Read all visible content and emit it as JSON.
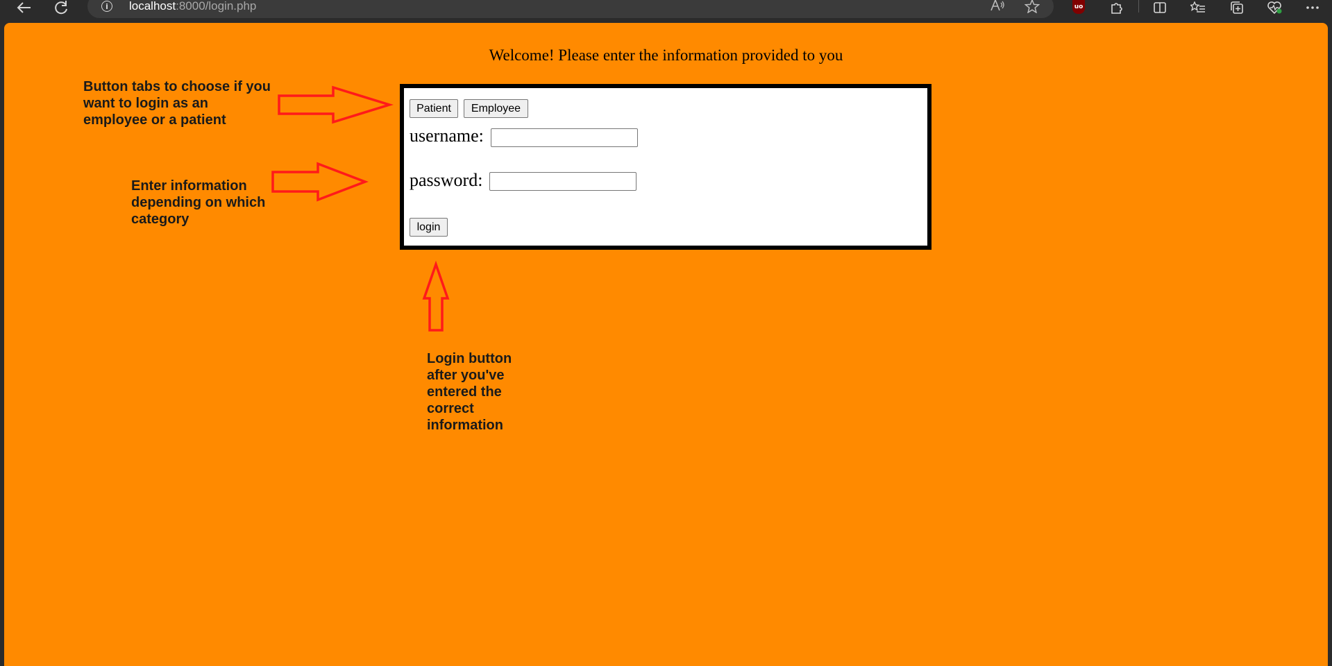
{
  "browser": {
    "url_host": "localhost",
    "url_path": ":8000/login.php",
    "ublock_badge": "uo"
  },
  "page": {
    "welcome": "Welcome! Please enter the information provided to you",
    "tabs": [
      "Patient",
      "Employee"
    ],
    "username_label": "username:",
    "password_label": "password:",
    "username_value": "",
    "password_value": "",
    "login_label": "login",
    "background_color": "#ff8a00"
  },
  "annotations": {
    "tabs_note": "Button tabs to choose if you want to login as an employee or a patient",
    "fields_note": "Enter information depending on which category",
    "login_note": "Login button after you've entered the correct information",
    "arrow_color": "#ff1a1a"
  }
}
